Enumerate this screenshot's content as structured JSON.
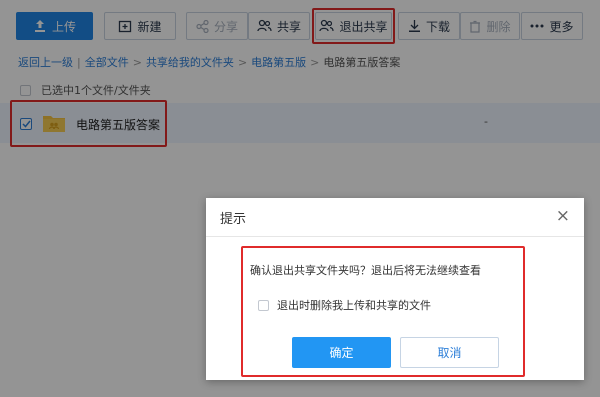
{
  "toolbar": {
    "upload": "上传",
    "new": "新建",
    "share": "分享",
    "co_share": "共享",
    "exit_share": "退出共享",
    "download": "下载",
    "delete": "删除",
    "more": "更多"
  },
  "breadcrumb": {
    "back": "返回上一级",
    "all_files": "全部文件",
    "shared_folder": "共享给我的文件夹",
    "circuit": "电路第五版",
    "current": "电路第五版答案"
  },
  "selection": {
    "text": "已选中1个文件/文件夹"
  },
  "file": {
    "name": "电路第五版答案",
    "size": "-"
  },
  "dialog": {
    "title": "提示",
    "close_symbol": "×",
    "message": "确认退出共享文件夹吗？退出后将无法继续查看",
    "option": "退出时删除我上传和共享的文件",
    "ok": "确定",
    "cancel": "取消"
  },
  "colors": {
    "primary": "#1f86e6",
    "highlight": "#e02b2b",
    "link": "#2d7fd8",
    "folder": "#f5c342"
  }
}
